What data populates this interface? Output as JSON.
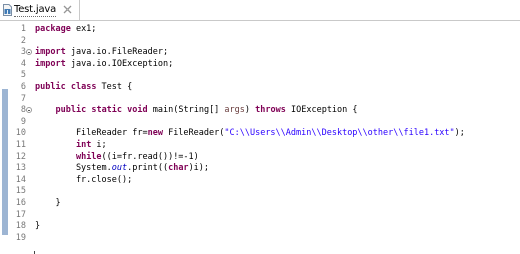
{
  "tab": {
    "title": "Test.java",
    "icon": "java-file-icon",
    "close_icon": "close-icon"
  },
  "editor": {
    "lines": [
      {
        "number": "1",
        "fold": false,
        "tokens": [
          {
            "t": "kw",
            "v": "package"
          },
          {
            "t": "plain",
            "v": " ex1;"
          }
        ]
      },
      {
        "number": "2",
        "fold": false,
        "tokens": []
      },
      {
        "number": "3",
        "fold": true,
        "tokens": [
          {
            "t": "kw",
            "v": "import"
          },
          {
            "t": "plain",
            "v": " java.io.FileReader;"
          }
        ]
      },
      {
        "number": "4",
        "fold": false,
        "tokens": [
          {
            "t": "kw",
            "v": "import"
          },
          {
            "t": "plain",
            "v": " java.io.IOException;"
          }
        ]
      },
      {
        "number": "5",
        "fold": false,
        "tokens": []
      },
      {
        "number": "6",
        "fold": false,
        "tokens": [
          {
            "t": "kw",
            "v": "public"
          },
          {
            "t": "plain",
            "v": " "
          },
          {
            "t": "kw",
            "v": "class"
          },
          {
            "t": "plain",
            "v": " Test {"
          }
        ]
      },
      {
        "number": "7",
        "fold": false,
        "tokens": []
      },
      {
        "number": "8",
        "fold": true,
        "tokens": [
          {
            "t": "plain",
            "v": "    "
          },
          {
            "t": "kw",
            "v": "public"
          },
          {
            "t": "plain",
            "v": " "
          },
          {
            "t": "kw",
            "v": "static"
          },
          {
            "t": "plain",
            "v": " "
          },
          {
            "t": "kw",
            "v": "void"
          },
          {
            "t": "plain",
            "v": " main(String[] "
          },
          {
            "t": "param",
            "v": "args"
          },
          {
            "t": "plain",
            "v": ") "
          },
          {
            "t": "kw",
            "v": "throws"
          },
          {
            "t": "plain",
            "v": " IOException {"
          }
        ]
      },
      {
        "number": "9",
        "fold": false,
        "tokens": []
      },
      {
        "number": "10",
        "fold": false,
        "tokens": [
          {
            "t": "plain",
            "v": "        FileReader fr="
          },
          {
            "t": "kw",
            "v": "new"
          },
          {
            "t": "plain",
            "v": " FileReader("
          },
          {
            "t": "str",
            "v": "\"C:\\\\Users\\\\Admin\\\\Desktop\\\\other\\\\file1.txt\""
          },
          {
            "t": "plain",
            "v": ");"
          }
        ]
      },
      {
        "number": "11",
        "fold": false,
        "tokens": [
          {
            "t": "plain",
            "v": "        "
          },
          {
            "t": "kw",
            "v": "int"
          },
          {
            "t": "plain",
            "v": " i;"
          }
        ]
      },
      {
        "number": "12",
        "fold": false,
        "tokens": [
          {
            "t": "plain",
            "v": "        "
          },
          {
            "t": "kw",
            "v": "while"
          },
          {
            "t": "plain",
            "v": "((i=fr.read())!=-1)"
          }
        ]
      },
      {
        "number": "13",
        "fold": false,
        "tokens": [
          {
            "t": "plain",
            "v": "        System."
          },
          {
            "t": "static-field",
            "v": "out"
          },
          {
            "t": "plain",
            "v": ".print(("
          },
          {
            "t": "kw",
            "v": "char"
          },
          {
            "t": "plain",
            "v": ")i);"
          }
        ]
      },
      {
        "number": "14",
        "fold": false,
        "tokens": [
          {
            "t": "plain",
            "v": "        fr.close();"
          }
        ]
      },
      {
        "number": "15",
        "fold": false,
        "tokens": []
      },
      {
        "number": "16",
        "fold": false,
        "tokens": [
          {
            "t": "plain",
            "v": "    }"
          }
        ]
      },
      {
        "number": "17",
        "fold": false,
        "tokens": []
      },
      {
        "number": "18",
        "fold": false,
        "tokens": [
          {
            "t": "plain",
            "v": "}"
          }
        ]
      },
      {
        "number": "19",
        "fold": false,
        "tokens": []
      }
    ]
  },
  "colors": {
    "keyword": "#7f0055",
    "string": "#2a00ff",
    "parameter": "#6a3e3e",
    "static_field": "#0000c0",
    "line_number": "#787878",
    "ruler_highlight": "#9db5d3"
  }
}
